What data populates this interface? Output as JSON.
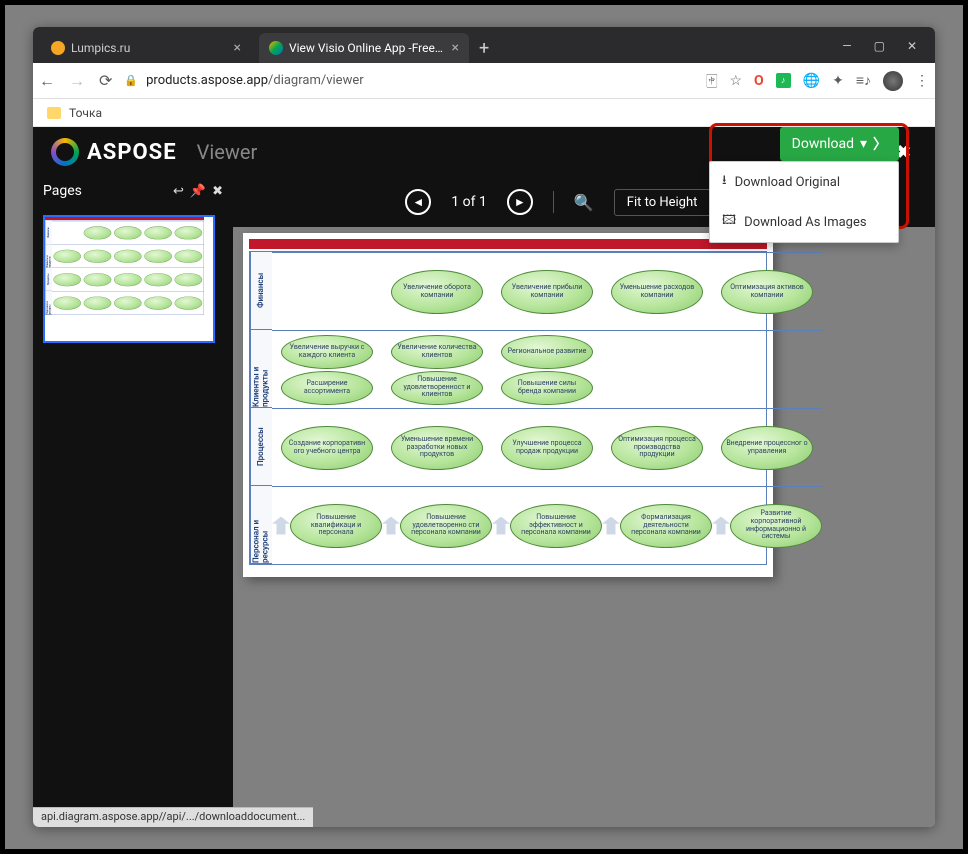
{
  "browser": {
    "tabs": [
      {
        "title": "Lumpics.ru",
        "favicon": "#f5a623",
        "active": false
      },
      {
        "title": "View Visio Online App -Free Onli",
        "favicon": "#28a745",
        "active": true
      }
    ],
    "url_domain": "products.aspose.app",
    "url_path": "/diagram/viewer",
    "bookmark": "Точка",
    "status_bar": "api.diagram.aspose.app//api/.../downloaddocument..."
  },
  "app": {
    "brand": "ASPOSE",
    "section": "Viewer",
    "download_label": "Download",
    "download_menu": {
      "original": "Download Original",
      "images": "Download As Images"
    },
    "pages_label": "Pages",
    "page_counter": "1 of 1",
    "zoom_mode": "Fit to Height"
  },
  "diagram": {
    "rows": [
      "Финансы",
      "Клиенты и продукты",
      "Процессы",
      "Персонал и ресурсы"
    ],
    "r1": [
      "Увеличение оборота компании",
      "Увеличение прибыли компании",
      "Уменьшение расходов компании",
      "Оптимизация активов компании"
    ],
    "r2": [
      "Увеличение выручки с каждого клиента",
      "Увеличение количества клиентов",
      "Региональное развитие",
      "Расширение ассортимента",
      "Повышение удовлетворенност и клиентов",
      "Повышение силы бренда компании"
    ],
    "r3": [
      "Создание корпоративн ого учебного центра",
      "Уменьшение времени разработки новых продуктов",
      "Улучшение процесса продаж продукции",
      "Оптимизация процесса производства продукции",
      "Внедрение процессног о управления"
    ],
    "r4": [
      "Повышение квалификаци и персонала",
      "Повышение удовлетворенно сти персонала компании",
      "Повышение эффективност и персонала компании",
      "Формализация деятельности персонала компании",
      "Развитие корпоративной информационно й системы"
    ]
  }
}
